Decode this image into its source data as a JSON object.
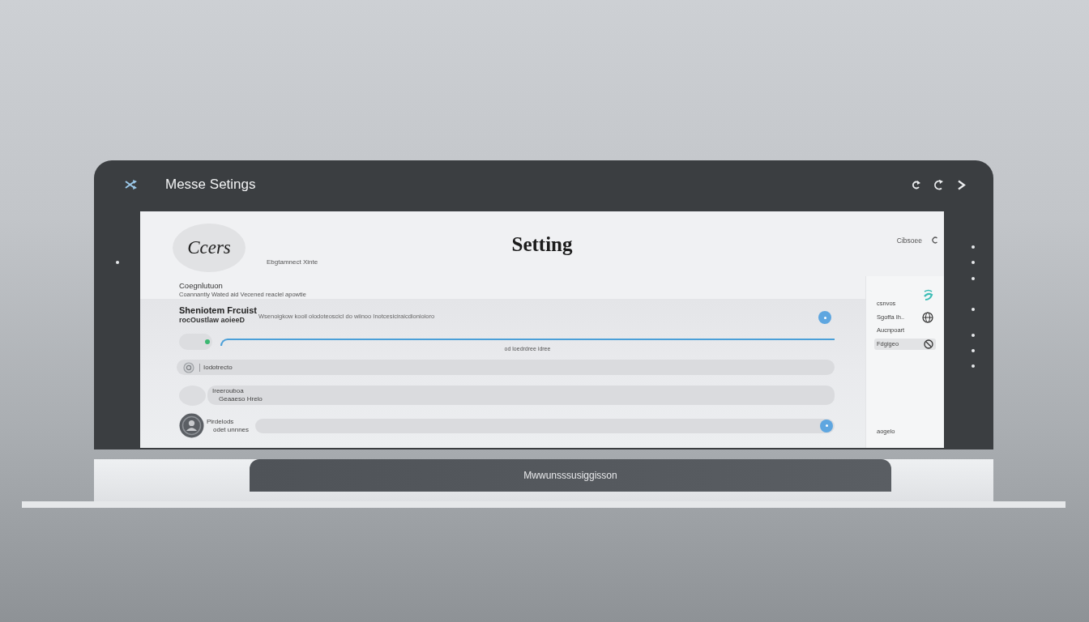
{
  "window": {
    "title": "Messe Setings"
  },
  "header": {
    "avatar_text": "Ccers",
    "subtitle": "Ebgtamnect Xinte",
    "heading": "Setting",
    "action": "Cibsoee"
  },
  "section": {
    "title": "Coegnlutuon",
    "description": "Coannantiy Wated aid Vecened reaclel apowtie"
  },
  "rows": [
    {
      "kind": "toggle",
      "title": "Sheniotem Frcuist",
      "subtitle": "rocOustlaw aoieeD",
      "description": "Wsenoigkow kooil olodoteoscicl do wiinoo Inotcesiciraicdionioioro",
      "on": true
    },
    {
      "kind": "input",
      "on": true,
      "caption": "od loedrdree idree"
    },
    {
      "kind": "option",
      "title": "Iodotrecto"
    },
    {
      "kind": "entry",
      "title": "Ireerouboa",
      "subtitle": "Geaaeso Hrelo"
    },
    {
      "kind": "account",
      "title": "Pirdelods",
      "subtitle": "odet unnnes",
      "on": true
    }
  ],
  "side_panel": {
    "items": [
      {
        "label": "csnvos",
        "kind": "swirl",
        "selected": false
      },
      {
        "label": "Sgoffa Ih..",
        "kind": "globe",
        "selected": false
      },
      {
        "label": "Aucnpoart",
        "kind": "plain",
        "selected": false
      },
      {
        "label": "Fdgigeo",
        "kind": "blocked",
        "selected": true
      },
      {
        "label": "aogelo",
        "kind": "plain",
        "selected": false
      }
    ]
  },
  "footer": {
    "label": "Mwwunsssusiggisson"
  }
}
